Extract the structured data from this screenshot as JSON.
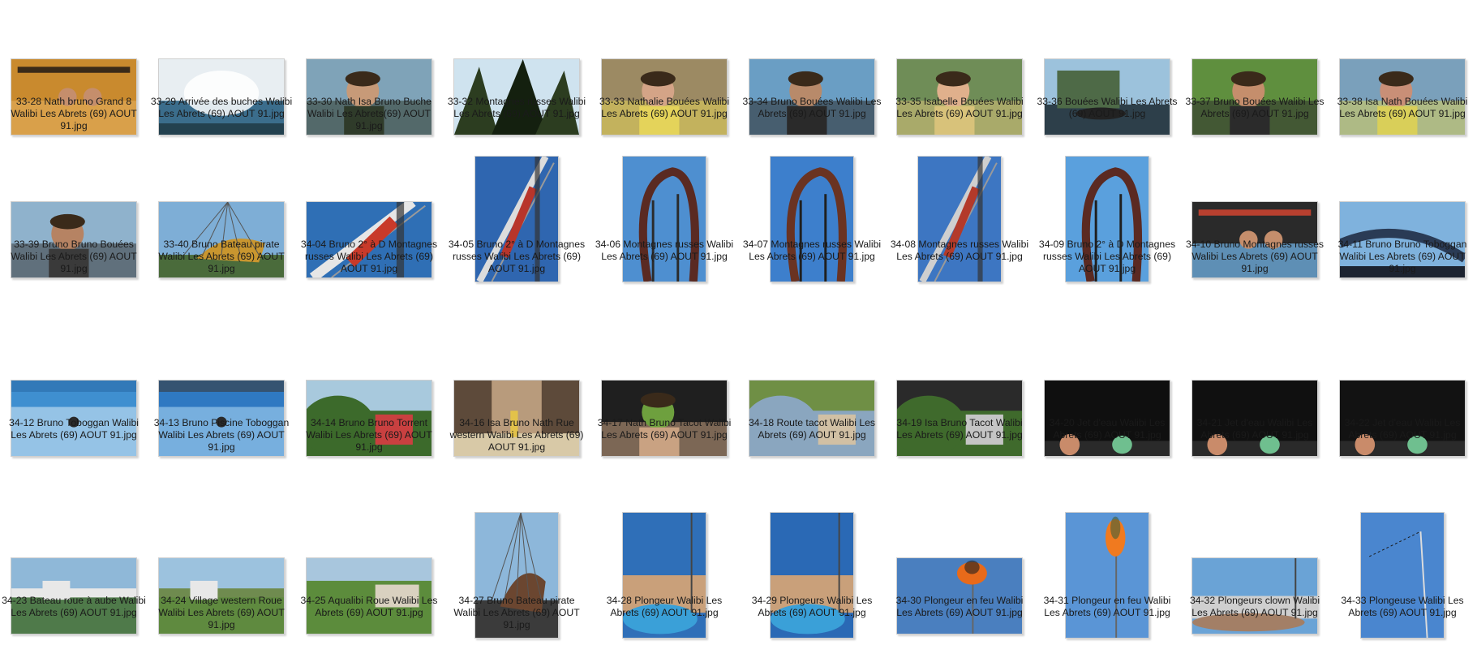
{
  "files": [
    {
      "name": "33-28 Nath bruno Grand 8 Walibi Les Abrets (69) AOUT 91.jpg",
      "orientation": "landscape",
      "scene": "coaster-car",
      "colors": [
        "#c98a2e",
        "#d9a04a",
        "#3a2a18"
      ]
    },
    {
      "name": "33-29 Arrivée des buches Walibi Les Abrets (69) AOUT 91.jpg",
      "orientation": "landscape",
      "scene": "splash",
      "colors": [
        "#e8eef2",
        "#3b6d8c",
        "#23414f"
      ]
    },
    {
      "name": "33-30 Nath Isa Bruno Buche Walibi Les Abrets(69) AOUT 91.jpg",
      "orientation": "landscape",
      "scene": "people",
      "colors": [
        "#7fa3b8",
        "#c79a78",
        "#2f3b2a"
      ]
    },
    {
      "name": "33-32 Montagnes russes Walibi Les Abrets (69) AOUT 91.jpg",
      "orientation": "landscape",
      "scene": "trees",
      "colors": [
        "#cfe3ef",
        "#2c3d20",
        "#14200f"
      ]
    },
    {
      "name": "33-33 Nathalie Bouées Walibi Les Abrets (69) AOUT 91.jpg",
      "orientation": "landscape",
      "scene": "people",
      "colors": [
        "#9c8a63",
        "#d4a487",
        "#e4d35a"
      ]
    },
    {
      "name": "33-34 Bruno Bouées Walibi Les Abrets (69) AOUT 91.jpg",
      "orientation": "landscape",
      "scene": "people",
      "colors": [
        "#6a9ec4",
        "#b88a6a",
        "#2a2a2a"
      ]
    },
    {
      "name": "33-35 Isabelle Bouées Walibi Les Abrets (69) AOUT 91.jpg",
      "orientation": "landscape",
      "scene": "people",
      "colors": [
        "#6f8d57",
        "#e0b08c",
        "#d8c27a"
      ]
    },
    {
      "name": "33-36 Bouées Walibi Les Abrets (69) AOUT 91.jpg",
      "orientation": "landscape",
      "scene": "water-ride",
      "colors": [
        "#9cc2dc",
        "#4e6a47",
        "#2d3f4a"
      ]
    },
    {
      "name": "33-37 Bruno Bouées Walibi Les Abrets (69) AOUT 91.jpg",
      "orientation": "landscape",
      "scene": "people",
      "colors": [
        "#5f8f3e",
        "#c58e6c",
        "#2b2b2b"
      ]
    },
    {
      "name": "33-38 Isa Nath Bouées Walibi Les Abrets (69) AOUT 91.jpg",
      "orientation": "landscape",
      "scene": "people",
      "colors": [
        "#7aa0bb",
        "#c98f77",
        "#d9cf59"
      ]
    },
    {
      "name": "33-39 Bruno Bruno Bouées Walibi Les Abrets (69) AOUT 91.jpg",
      "orientation": "landscape",
      "scene": "people",
      "colors": [
        "#8fb2cc",
        "#b68363",
        "#3a3a3a"
      ]
    },
    {
      "name": "33-40 Bruno Bateau pirate Walibi Les Abrets (69) AOUT 91.jpg",
      "orientation": "landscape",
      "scene": "pirate",
      "colors": [
        "#7eaed6",
        "#c9962f",
        "#4a6b3b"
      ]
    },
    {
      "name": "34-04 Bruno 2° à D Montagnes russes Walibi Les Abrets (69) AOUT 91.jpg",
      "orientation": "landscape",
      "scene": "coaster-track",
      "colors": [
        "#2f6fb5",
        "#c83a2a",
        "#e6e6e6"
      ]
    },
    {
      "name": "34-05 Bruno 2° à D Montagnes russes Walibi Les Abrets (69) AOUT 91.jpg",
      "orientation": "portrait",
      "scene": "coaster-track",
      "colors": [
        "#2f66b0",
        "#b8352b",
        "#dcdcdc"
      ]
    },
    {
      "name": "34-06 Montagnes russes Walibi Les Abrets (69) AOUT 91.jpg",
      "orientation": "portrait",
      "scene": "coaster-loop",
      "colors": [
        "#4e8fd0",
        "#5a2a22",
        "#2b2b2b"
      ]
    },
    {
      "name": "34-07 Montagnes russes Walibi Les Abrets (69) AOUT 91.jpg",
      "orientation": "portrait",
      "scene": "coaster-loop",
      "colors": [
        "#3d7fcc",
        "#6a3322",
        "#1f1f1f"
      ]
    },
    {
      "name": "34-08 Montagnes russes Walibi Les Abrets (69) AOUT 91.jpg",
      "orientation": "portrait",
      "scene": "coaster-track",
      "colors": [
        "#3d76c2",
        "#b33a2a",
        "#cfcfcf"
      ]
    },
    {
      "name": "34-09 Bruno 2° à D Montagnes russes Walibi Les Abrets (69) AOUT 91.jpg",
      "orientation": "portrait",
      "scene": "coaster-loop",
      "colors": [
        "#5aa0dd",
        "#5b2a22",
        "#1f1f1f"
      ]
    },
    {
      "name": "34-10 Bruno Montagnes russes Walibi Les Abrets (69) AOUT 91.jpg",
      "orientation": "landscape",
      "scene": "coaster-car",
      "colors": [
        "#2a2a2a",
        "#5e8fb5",
        "#b8402f"
      ]
    },
    {
      "name": "34-11 Bruno Bruno Toboggan Walibi Les Abrets (69) AOUT 91.jpg",
      "orientation": "landscape",
      "scene": "slide",
      "colors": [
        "#7fb2dd",
        "#2a3b55",
        "#1c2330"
      ]
    },
    {
      "name": "34-12 Bruno Toboggan Walibi Les Abrets (69) AOUT 91.jpg",
      "orientation": "landscape",
      "scene": "pool",
      "colors": [
        "#3f8fd0",
        "#cfe6f5",
        "#2a6aa8"
      ]
    },
    {
      "name": "34-13 Bruno Piscine Toboggan Walibi Les Abrets (69) AOUT 91.jpg",
      "orientation": "landscape",
      "scene": "pool",
      "colors": [
        "#2f79c2",
        "#a9d3f0",
        "#3b3b3b"
      ]
    },
    {
      "name": "34-14 Bruno Bruno Torrent Walibi Les Abrets (69) AOUT 91.jpg",
      "orientation": "landscape",
      "scene": "garden",
      "colors": [
        "#3c6a2b",
        "#a8c9dd",
        "#c94040"
      ]
    },
    {
      "name": "34-16 Isa Bruno Nath Rue western Walibi Les Abrets (69) AOUT 91.jpg",
      "orientation": "landscape",
      "scene": "street",
      "colors": [
        "#b89b7c",
        "#5d4a3a",
        "#d8c9a7"
      ]
    },
    {
      "name": "34-17 Nath Bruno Tacot Walibi Les Abrets (69) AOUT 91.jpg",
      "orientation": "landscape",
      "scene": "people",
      "colors": [
        "#1f1f1f",
        "#6ea03e",
        "#c9a282"
      ]
    },
    {
      "name": "34-18 Route tacot Walibi Les Abrets (69) AOUT 91.jpg",
      "orientation": "landscape",
      "scene": "garden",
      "colors": [
        "#8aa6bf",
        "#6f8f45",
        "#d1c0a4"
      ]
    },
    {
      "name": "34-19 Isa Bruno Tacot Walibi Les Abrets (69) AOUT 91.jpg",
      "orientation": "landscape",
      "scene": "garden",
      "colors": [
        "#3f6a2c",
        "#2a2a2a",
        "#c5c5c5"
      ]
    },
    {
      "name": "34-20 Jet d'eau Walibi Les Abrets (69) AOUT 91.jpg",
      "orientation": "landscape",
      "scene": "night",
      "colors": [
        "#0f0f0f",
        "#c98b6a",
        "#6fbf8f"
      ]
    },
    {
      "name": "34-21 Jet d'eau Walibi Les Abrets (69) AOUT 91.jpg",
      "orientation": "landscape",
      "scene": "night",
      "colors": [
        "#101010",
        "#c98b6a",
        "#6fbf8f"
      ]
    },
    {
      "name": "34-22 Jet d'eau Walibi Les Abrets (69) AOUT 91.jpg",
      "orientation": "landscape",
      "scene": "night",
      "colors": [
        "#121212",
        "#c98b6a",
        "#6fbf8f"
      ]
    },
    {
      "name": "34-23 Bateau roue à aube Walibi Les Abrets (69) AOUT 91.jpg",
      "orientation": "landscape",
      "scene": "lake",
      "colors": [
        "#8fb8d8",
        "#4f7a4a",
        "#e8e8e8"
      ]
    },
    {
      "name": "34-24 Village western Roue Walibi Les Abrets (69) AOUT 91.jpg",
      "orientation": "landscape",
      "scene": "lake",
      "colors": [
        "#9cc2de",
        "#5f8a3f",
        "#6f8b4f"
      ]
    },
    {
      "name": "34-25 Aqualibi Roue Walibi Les Abrets (69) AOUT 91.jpg",
      "orientation": "landscape",
      "scene": "aerial",
      "colors": [
        "#a8c6dd",
        "#5c8c3c",
        "#d9d1c0"
      ]
    },
    {
      "name": "34-27 Bruno Bateau pirate Walibi Les Abrets (69) AOUT 91.jpg",
      "orientation": "portrait",
      "scene": "pirate",
      "colors": [
        "#8db7da",
        "#6b4630",
        "#3b3b3b"
      ]
    },
    {
      "name": "34-28 Plongeur Walibi Les Abrets (69) AOUT 91.jpg",
      "orientation": "portrait",
      "scene": "stadium",
      "colors": [
        "#2f6fb8",
        "#3aa0d8",
        "#c9a07a"
      ]
    },
    {
      "name": "34-29 Plongeurs Walibi Les Abrets (69) AOUT 91.jpg",
      "orientation": "portrait",
      "scene": "stadium",
      "colors": [
        "#2a69b5",
        "#3aa0d8",
        "#c9a07a"
      ]
    },
    {
      "name": "34-30 Plongeur en feu Walibi Les Abrets (69) AOUT 91.jpg",
      "orientation": "landscape",
      "scene": "fire",
      "colors": [
        "#4a7fbf",
        "#e86a1a",
        "#1f1f1f"
      ]
    },
    {
      "name": "34-31 Plongeur en feu Walibi Les Abrets (69) AOUT 91.jpg",
      "orientation": "portrait",
      "scene": "fire",
      "colors": [
        "#5a95d6",
        "#f07a1f",
        "#3f5f3a"
      ]
    },
    {
      "name": "34-32 Plongeurs clown Walibi Les Abrets (69) AOUT 91.jpg",
      "orientation": "landscape",
      "scene": "stadium",
      "colors": [
        "#6aa3d6",
        "#a37f66",
        "#cfcfcf"
      ]
    },
    {
      "name": "34-33 Plongeuse Walibi Les Abrets (69) AOUT 91.jpg",
      "orientation": "portrait",
      "scene": "pole",
      "colors": [
        "#4a86cf",
        "#dcdcdc",
        "#1a1a1a"
      ]
    }
  ]
}
